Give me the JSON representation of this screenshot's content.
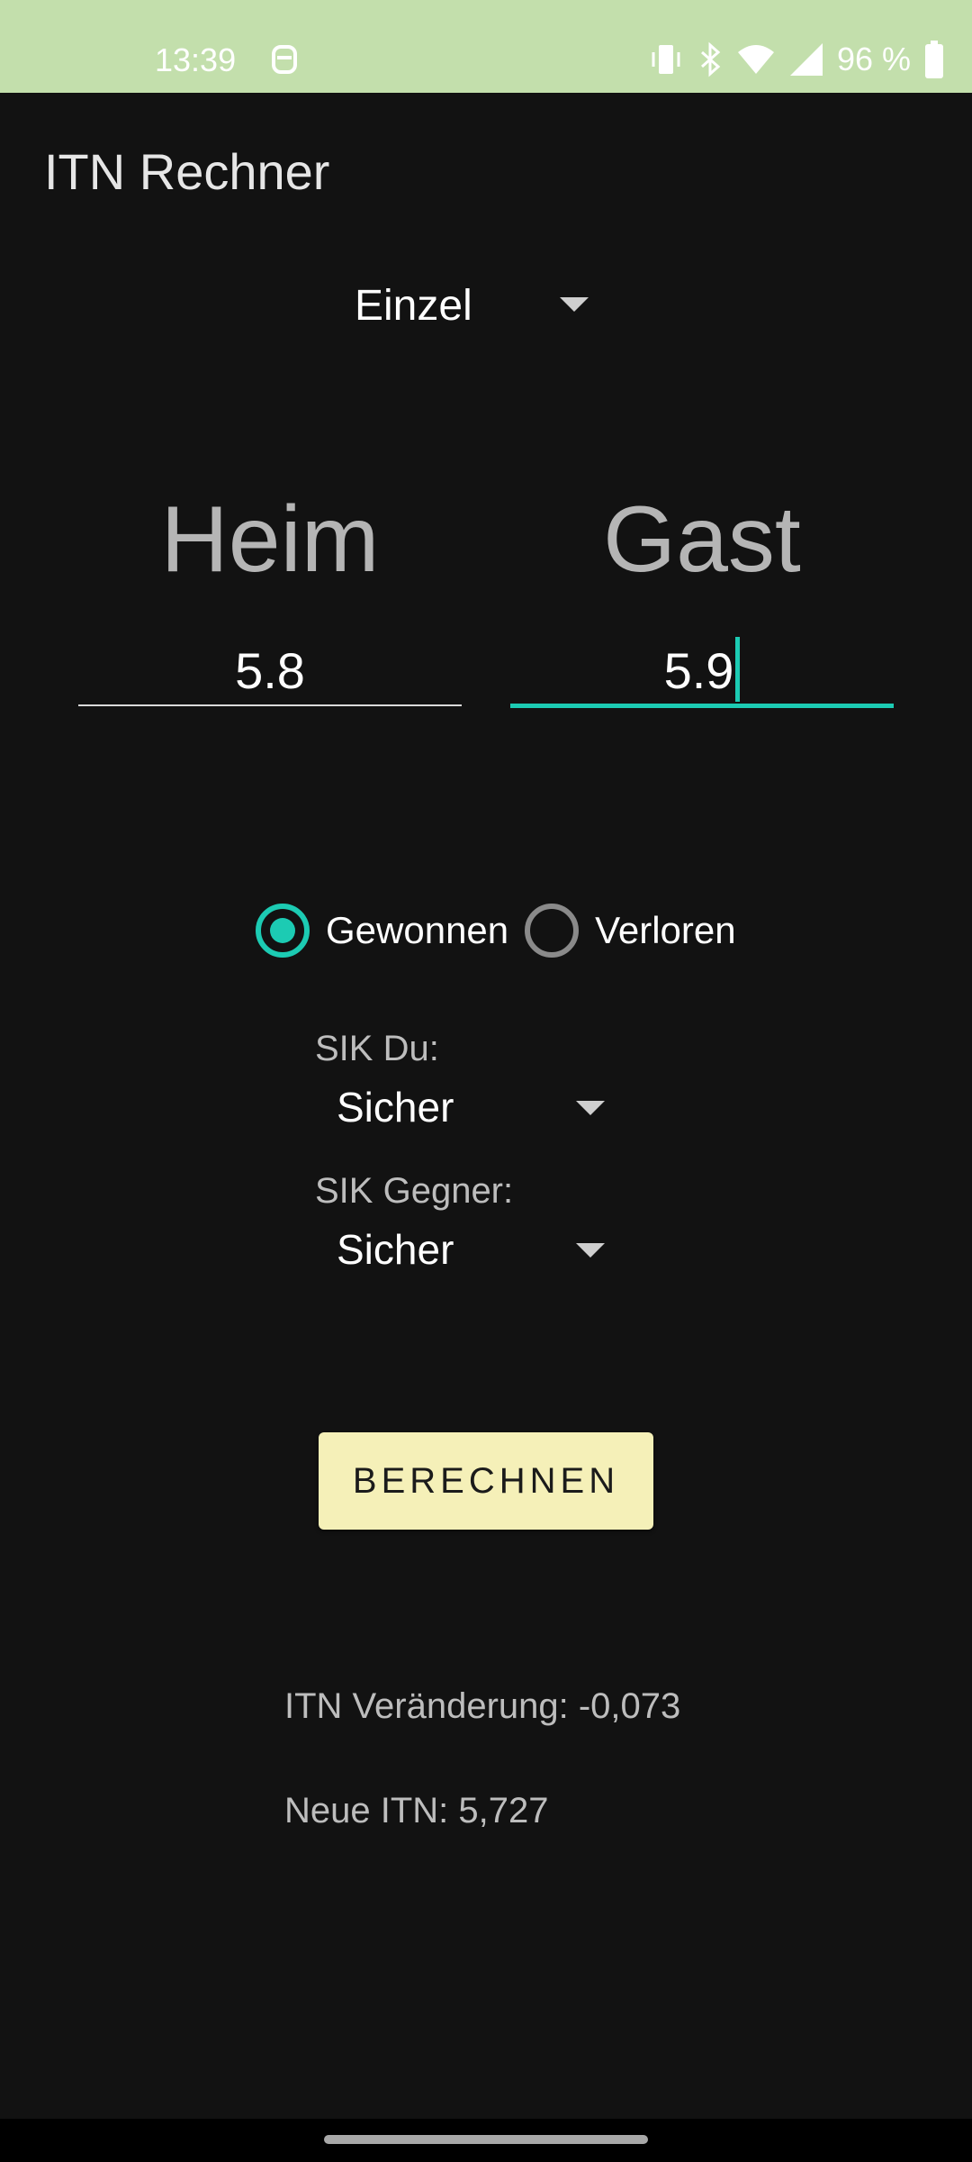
{
  "status_bar": {
    "time": "13:39",
    "battery": "96 %",
    "icons": [
      "app-notification-icon",
      "vibrate-icon",
      "bluetooth-icon",
      "wifi-icon",
      "cell-signal-icon",
      "battery-icon"
    ]
  },
  "app": {
    "title": "ITN Rechner"
  },
  "mode_spinner": {
    "value": "Einzel"
  },
  "columns": {
    "home_label": "Heim",
    "guest_label": "Gast"
  },
  "inputs": {
    "home_value": "5.8",
    "guest_value": "5.9"
  },
  "result_radio": {
    "options": [
      "Gewonnen",
      "Verloren"
    ],
    "selected": "Gewonnen"
  },
  "sik": {
    "self_label": "SIK Du:",
    "self_value": "Sicher",
    "opponent_label": "SIK Gegner:",
    "opponent_value": "Sicher"
  },
  "button": {
    "label": "BERECHNEN"
  },
  "results": {
    "change_text": "ITN Veränderung: -0,073",
    "new_text": "Neue ITN: 5,727"
  },
  "colors": {
    "accent": "#1ccbb3",
    "button_bg": "#f5f0b8",
    "status_bar_bg": "#c3dfac",
    "background": "#121212"
  }
}
